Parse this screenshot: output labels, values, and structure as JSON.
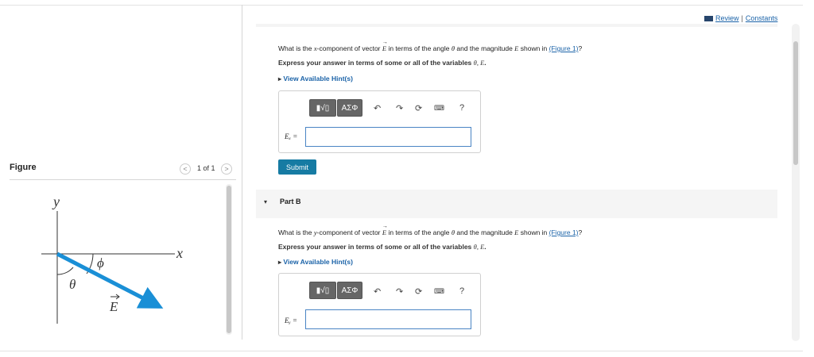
{
  "header": {
    "review_label": "Review",
    "separator": "|",
    "constants_label": "Constants"
  },
  "figure": {
    "title": "Figure",
    "prev_glyph": "<",
    "next_glyph": ">",
    "count": "1 of 1",
    "labels": {
      "y": "y",
      "x": "x",
      "phi": "ϕ",
      "theta": "θ",
      "E": "E"
    },
    "arrow_color": "#1a8fd6"
  },
  "partA": {
    "question_pre": "What is the ",
    "question_var": "x",
    "question_mid1": "-component of vector ",
    "question_vec": "E",
    "question_mid2": " in terms of the angle ",
    "question_theta": "θ",
    "question_mid3": " and the magnitude ",
    "question_mag": "E",
    "question_mid4": " shown in ",
    "figure_link": "(Figure 1)",
    "question_end": "?",
    "instruction_pre": "Express your answer in terms of some or all of the variables ",
    "instruction_vars": "θ, E",
    "instruction_end": ".",
    "hint_label": "View Available Hint(s)",
    "hint_caret": "▸",
    "tool_templates": "▮√▯",
    "tool_symbols": "ΑΣΦ",
    "help_glyph": "?",
    "answer_label": "Eₓ =",
    "answer_value": "",
    "submit_label": "Submit"
  },
  "partB": {
    "caret": "▾",
    "label": "Part B",
    "question_pre": "What is the ",
    "question_var": "y",
    "question_mid1": "-component of vector ",
    "question_vec": "E",
    "question_mid2": " in terms of the angle ",
    "question_theta": "θ",
    "question_mid3": " and the magnitude ",
    "question_mag": "E",
    "question_mid4": " shown in ",
    "figure_link": "(Figure 1)",
    "question_end": "?",
    "instruction_pre": "Express your answer in terms of some or all of the variables ",
    "instruction_vars": "θ, E",
    "instruction_end": ".",
    "hint_label": "View Available Hint(s)",
    "hint_caret": "▸",
    "tool_templates": "▮√▯",
    "tool_symbols": "ΑΣΦ",
    "help_glyph": "?",
    "answer_label": "Eᵧ =",
    "answer_value": ""
  }
}
